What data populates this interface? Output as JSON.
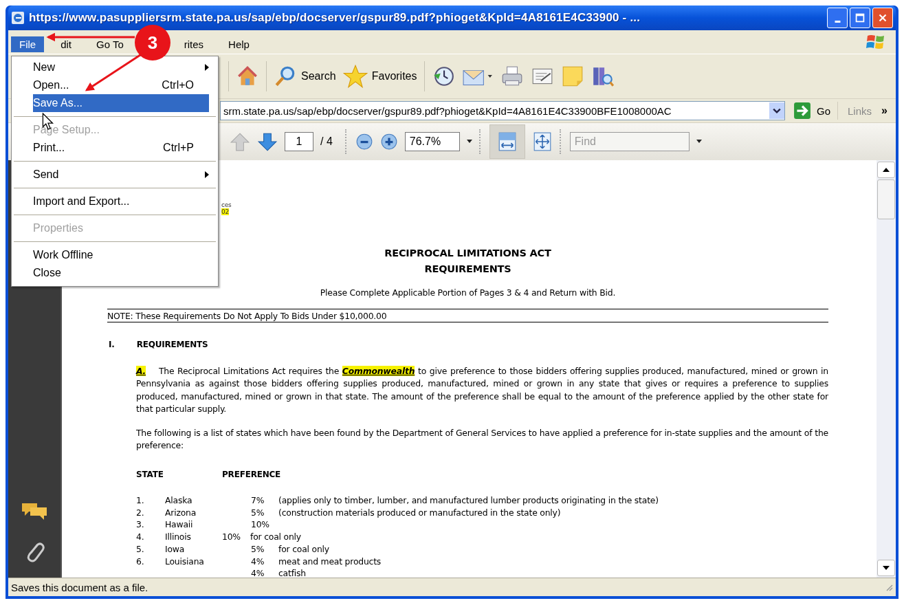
{
  "window": {
    "title": "https://www.pasuppliersrm.state.pa.us/sap/ebp/docserver/gspur89.pdf?phioget&KpId=4A8161E4C33900 - ..."
  },
  "menu_bar": [
    {
      "label": "File",
      "selected": true
    },
    {
      "label": "dit",
      "selected": false
    },
    {
      "label": "Go To",
      "selected": false
    },
    {
      "label": "rites",
      "selected": false
    },
    {
      "label": "Help",
      "selected": false
    }
  ],
  "file_menu": [
    {
      "label": "New",
      "submenu": true,
      "disabled": false,
      "selected": false
    },
    {
      "label": "Open...",
      "shortcut": "Ctrl+O",
      "disabled": false,
      "selected": false
    },
    {
      "label": "Save As...",
      "disabled": false,
      "selected": true,
      "separator_after": true
    },
    {
      "label": "Page Setup...",
      "disabled": true,
      "selected": false
    },
    {
      "label": "Print...",
      "shortcut": "Ctrl+P",
      "disabled": false,
      "selected": false,
      "separator_after": true
    },
    {
      "label": "Send",
      "submenu": true,
      "disabled": false,
      "selected": false,
      "separator_after": true
    },
    {
      "label": "Import and Export...",
      "disabled": false,
      "selected": false,
      "separator_after": true
    },
    {
      "label": "Properties",
      "disabled": true,
      "selected": false,
      "separator_after": true
    },
    {
      "label": "Work Offline",
      "disabled": false,
      "selected": false
    },
    {
      "label": "Close",
      "disabled": false,
      "selected": false
    }
  ],
  "toolbar": [
    {
      "kind": "home"
    },
    {
      "kind": "search",
      "label": "Search"
    },
    {
      "kind": "favorites",
      "label": "Favorites"
    },
    {
      "kind": "history"
    },
    {
      "kind": "mail"
    },
    {
      "kind": "print"
    },
    {
      "kind": "edit"
    },
    {
      "kind": "note"
    },
    {
      "kind": "research"
    }
  ],
  "address_bar": {
    "value": "srm.state.pa.us/sap/ebp/docserver/gspur89.pdf?phioget&KpId=4A8161E4C33900BFE1008000AC",
    "go": "Go",
    "links": "Links",
    "more": "»"
  },
  "pdf_toolbar": {
    "page": "1",
    "page_total": "/ 4",
    "zoom": "76.7%",
    "find_placeholder": "Find",
    "fit_width_selected": true
  },
  "document": {
    "fragments": [
      {
        "text": "ces",
        "highlight": false
      },
      {
        "text": "02",
        "highlight": true
      }
    ],
    "title": [
      "RECIPROCAL LIMITATIONS ACT",
      "REQUIREMENTS"
    ],
    "subtitle": "Please Complete Applicable Portion of Pages 3 & 4 and Return with Bid.",
    "note": "NOTE:  These Requirements Do Not Apply To Bids Under $10,000.00",
    "section": {
      "number": "I.",
      "heading": "REQUIREMENTS"
    },
    "paragraph_a": {
      "marker": "A.",
      "text": "The Reciprocal Limitations Act requires the **Commonwealth** to give preference to those bidders offering supplies produced, manufactured, mined or grown in Pennsylvania as against those bidders offering supplies produced, manufactured, mined or grown in any state that gives or requires a preference to supplies produced, manufactured, mined or grown in that state.  The amount of the preference shall be equal to the amount of the preference applied by the other state for that particular supply."
    },
    "paragraph_b": "The following is a list of states which have been found by the Department of General Services to have applied a preference for in-state supplies and the amount of the preference:",
    "headers": [
      "STATE",
      "PREFERENCE"
    ],
    "rows": [
      {
        "kind": "normal",
        "number": "1.",
        "state": "Alaska",
        "percent": "7%",
        "note": "(applies only to timber, lumber, and manufactured lumber products originating in the state)"
      },
      {
        "kind": "normal",
        "number": "2.",
        "state": "Arizona",
        "percent": "5%",
        "note": "(construction materials produced or manufactured in the state only)"
      },
      {
        "kind": "normal",
        "number": "3.",
        "state": "Hawaii",
        "percent": "10%"
      },
      {
        "kind": "shifted",
        "number": "4.",
        "state": "Illinois",
        "percent": "10%",
        "note": "for coal only"
      },
      {
        "kind": "normal",
        "number": "5.",
        "state": "Iowa",
        "percent": "5%",
        "note": "for coal only"
      },
      {
        "kind": "normal",
        "number": "6.",
        "state": "Louisiana",
        "percent": "4%",
        "note": "meat and meat products"
      },
      {
        "kind": "normal",
        "percent": "4%",
        "note": "catfish"
      }
    ]
  },
  "status_bar": "Saves this document as a file.",
  "callout": {
    "label": "3"
  }
}
